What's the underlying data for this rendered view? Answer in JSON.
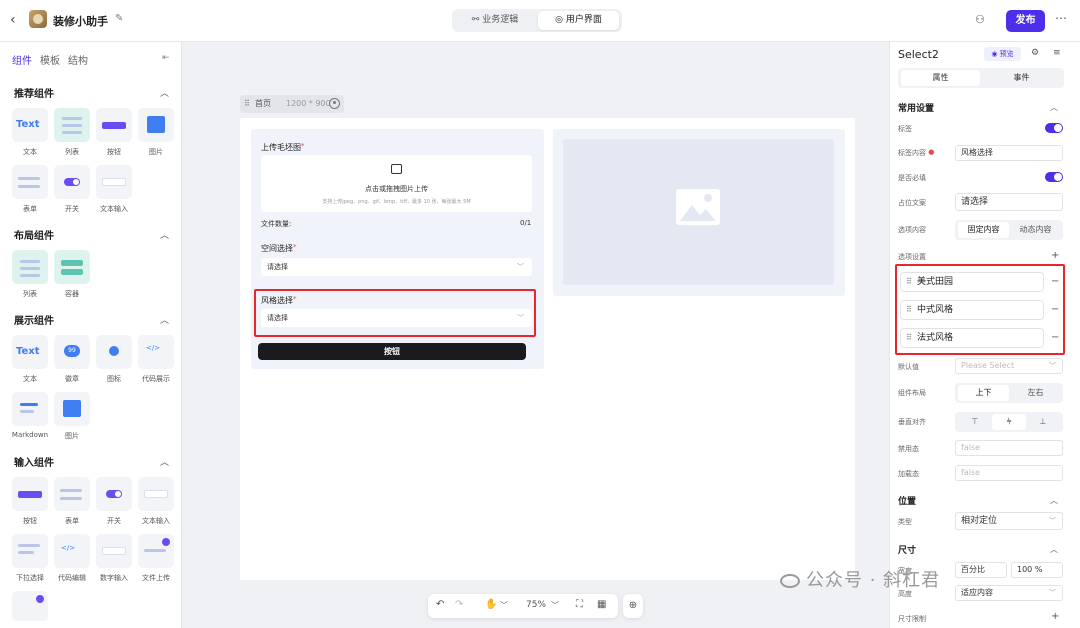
{
  "header": {
    "app_name": "装修小助手",
    "tabs": [
      "业务逻辑",
      "用户界面"
    ],
    "active_tab": "用户界面",
    "publish_label": "发布"
  },
  "left_panel": {
    "tabs": [
      "组件",
      "模板",
      "结构"
    ],
    "sections": [
      {
        "title": "推荐组件",
        "items": [
          "文本",
          "列表",
          "按钮",
          "图片",
          "表单",
          "开关",
          "文本输入"
        ]
      },
      {
        "title": "布局组件",
        "items": [
          "列表",
          "容器"
        ]
      },
      {
        "title": "展示组件",
        "items": [
          "文本",
          "徽章",
          "图标",
          "代码展示",
          "Markdown",
          "图片"
        ]
      },
      {
        "title": "输入组件",
        "items": [
          "按钮",
          "表单",
          "开关",
          "文本输入",
          "下拉选择",
          "代码编辑",
          "数字输入",
          "文件上传"
        ]
      }
    ],
    "tile_texts": {
      "text": "Text",
      "badge": "99",
      "button": "Button"
    }
  },
  "canvas": {
    "page_name": "首页",
    "page_size": "1200 * 900",
    "upload_label": "上传毛坯图",
    "upload_text": "点击或拖拽图片上传",
    "upload_hint": "支持上传jpeg、png、gif、bmp、tiff，最多 10 张，每张最大 5M",
    "count_label": "文件数量:",
    "count_value": "0/1",
    "space_label": "空间选择",
    "space_placeholder": "请选择",
    "style_label": "风格选择",
    "style_placeholder": "请选择",
    "button_label": "按钮",
    "zoom": "75%"
  },
  "right_panel": {
    "component_name": "Select2",
    "preview_label": "预览",
    "tabs": [
      "属性",
      "事件"
    ],
    "active_tab": "属性",
    "common_settings": "常用设置",
    "label_label": "标签",
    "label_content_label": "标签内容",
    "label_content_value": "风格选择",
    "required_label": "是否必填",
    "placeholder_label": "占位文案",
    "placeholder_value": "请选择",
    "options_content_label": "选项内容",
    "options_modes": [
      "固定内容",
      "动态内容"
    ],
    "options_settings_label": "选项设置",
    "options": [
      "美式田园",
      "中式风格",
      "法式风格"
    ],
    "default_label": "默认值",
    "default_placeholder": "Please Select",
    "layout_label": "组件布局",
    "layout_modes": [
      "上下",
      "左右"
    ],
    "valign_label": "垂直对齐",
    "disabled_label": "禁用态",
    "disabled_value": "false",
    "loading_label": "加载态",
    "loading_value": "false",
    "position_section": "位置",
    "type_label": "类型",
    "type_value": "相对定位",
    "size_section": "尺寸",
    "width_label": "宽度",
    "width_mode": "百分比",
    "width_value": "100",
    "width_unit": "%",
    "height_label": "高度",
    "height_value": "适应内容",
    "size_limit_label": "尺寸限制"
  },
  "watermark": "公众号 · 斜杠君",
  "colors": {
    "accent": "#4c2eeb",
    "highlight": "#e8262e",
    "dark_button": "#1b1b1f"
  }
}
